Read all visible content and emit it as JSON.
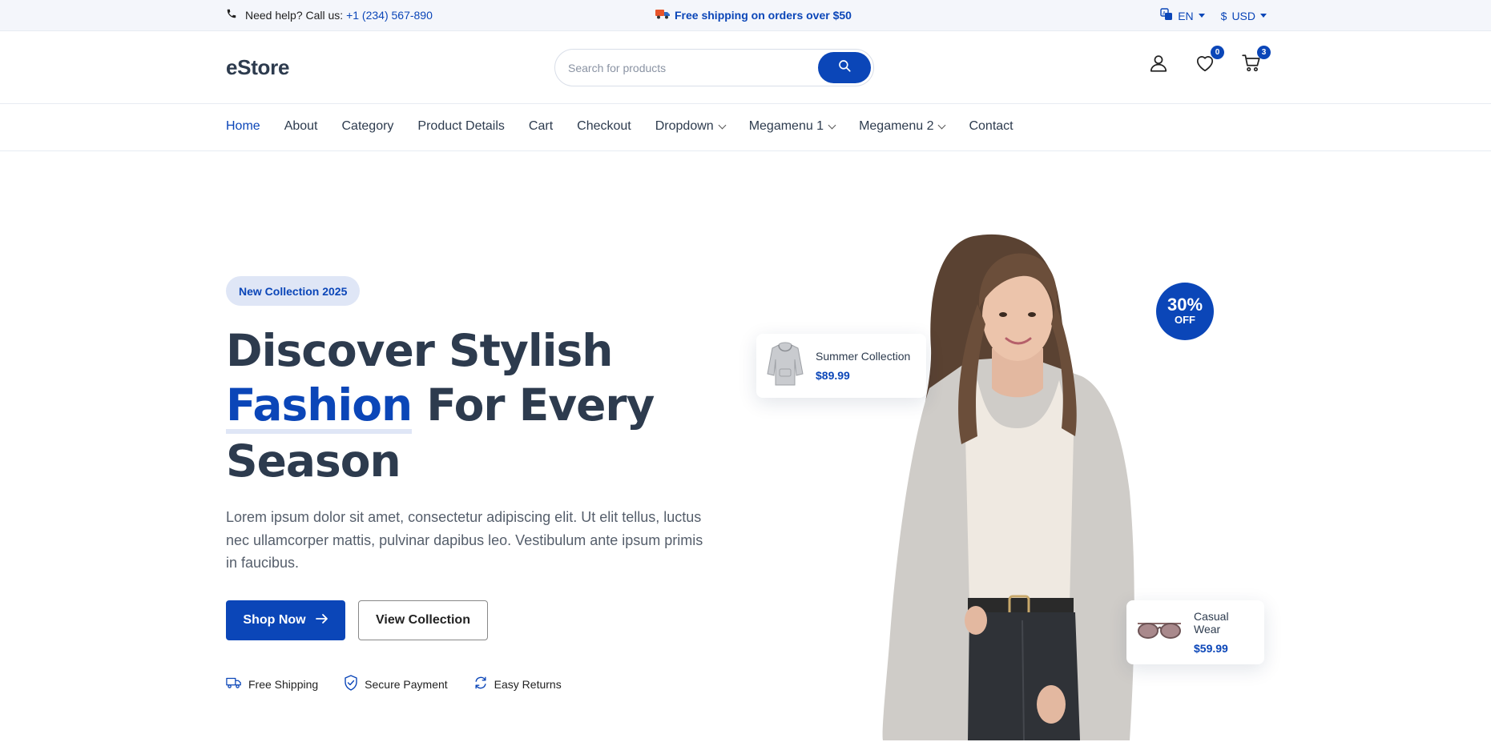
{
  "topbar": {
    "help_text": "Need help? Call us:",
    "phone": "+1 (234) 567-890",
    "shipping": "Free shipping on orders over $50",
    "language": "EN",
    "currency_symbol": "$",
    "currency": "USD"
  },
  "header": {
    "logo": "eStore",
    "search_placeholder": "Search for products",
    "wishlist_count": "0",
    "cart_count": "3"
  },
  "nav": {
    "items": [
      {
        "label": "Home",
        "active": true,
        "dropdown": false
      },
      {
        "label": "About",
        "dropdown": false
      },
      {
        "label": "Category",
        "dropdown": false
      },
      {
        "label": "Product Details",
        "dropdown": false
      },
      {
        "label": "Cart",
        "dropdown": false
      },
      {
        "label": "Checkout",
        "dropdown": false
      },
      {
        "label": "Dropdown",
        "dropdown": true
      },
      {
        "label": "Megamenu 1",
        "dropdown": true
      },
      {
        "label": "Megamenu 2",
        "dropdown": true
      },
      {
        "label": "Contact",
        "dropdown": false
      }
    ]
  },
  "hero": {
    "badge": "New Collection 2025",
    "headline_1": "Discover Stylish",
    "headline_accent": "Fashion",
    "headline_2": " For Every",
    "headline_3": "Season",
    "description": "Lorem ipsum dolor sit amet, consectetur adipiscing elit. Ut elit tellus, luctus nec ullamcorper mattis, pulvinar dapibus leo. Vestibulum ante ipsum primis in faucibus.",
    "primary_button": "Shop Now",
    "secondary_button": "View Collection",
    "features": [
      "Free Shipping",
      "Secure Payment",
      "Easy Returns"
    ]
  },
  "cards": {
    "card1": {
      "title": "Summer Collection",
      "price": "$89.99"
    },
    "card2": {
      "title": "Casual Wear",
      "price": "$59.99"
    }
  },
  "discount": {
    "percent": "30%",
    "label": "OFF"
  },
  "colors": {
    "accent": "#0b46b8",
    "text": "#2d3b4e",
    "tint": "#dfe6f6"
  }
}
